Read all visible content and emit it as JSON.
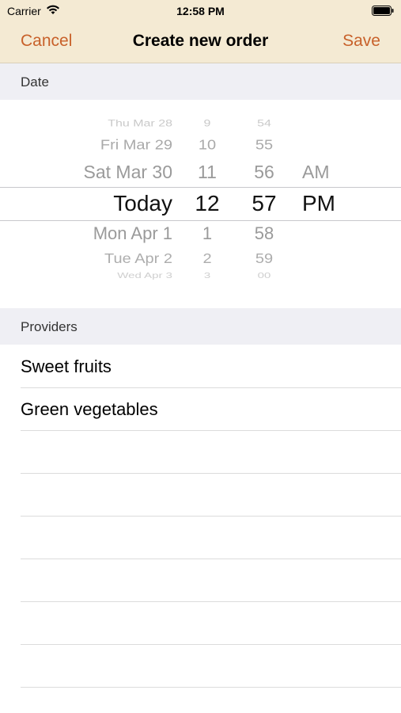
{
  "status_bar": {
    "carrier": "Carrier",
    "time": "12:58 PM",
    "wifi_icon": "wifi-icon",
    "battery_icon": "battery-icon"
  },
  "nav": {
    "cancel_label": "Cancel",
    "title": "Create new order",
    "save_label": "Save",
    "accent_color": "#c8612a",
    "bar_color": "#f4ead3"
  },
  "date_section": {
    "header": "Date",
    "picker": {
      "rows": [
        {
          "date": "Thu Mar 28",
          "hour": "9",
          "minute": "54",
          "ampm": ""
        },
        {
          "date": "Fri Mar 29",
          "hour": "10",
          "minute": "55",
          "ampm": ""
        },
        {
          "date": "Sat Mar 30",
          "hour": "11",
          "minute": "56",
          "ampm": "AM"
        },
        {
          "date": "Today",
          "hour": "12",
          "minute": "57",
          "ampm": "PM"
        },
        {
          "date": "Mon Apr 1",
          "hour": "1",
          "minute": "58",
          "ampm": ""
        },
        {
          "date": "Tue Apr 2",
          "hour": "2",
          "minute": "59",
          "ampm": ""
        },
        {
          "date": "Wed Apr 3",
          "hour": "3",
          "minute": "00",
          "ampm": ""
        }
      ],
      "selected_index": 3
    }
  },
  "providers_section": {
    "header": "Providers",
    "items": [
      {
        "label": "Sweet fruits"
      },
      {
        "label": "Green vegetables"
      }
    ]
  }
}
